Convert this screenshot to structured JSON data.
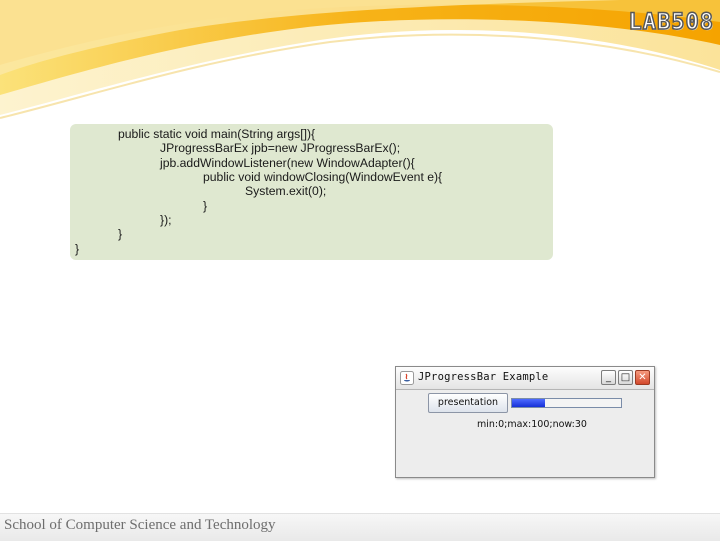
{
  "brand": "LAB508",
  "code_lines": [
    "public static void main(String args[]){",
    "JProgressBarEx jpb=new JProgressBarEx();",
    "jpb.addWindowListener(new WindowAdapter(){",
    "public void windowClosing(WindowEvent e){",
    "System.exit(0);",
    "}",
    "});",
    "}",
    "}"
  ],
  "java_window": {
    "title": "JProgressBar Example",
    "minimize": "_",
    "maximize": "□",
    "close": "✕",
    "button_label": "presentation",
    "progress": 0.3,
    "status": "min:0;max:100;now:30"
  },
  "footer": "School of Computer Science and Technology",
  "colors": {
    "code_background": "#dfe8d0",
    "swoosh_orange": "#f7b318",
    "progress_fill": "#1a36e0"
  },
  "icons": [
    "java-icon"
  ]
}
